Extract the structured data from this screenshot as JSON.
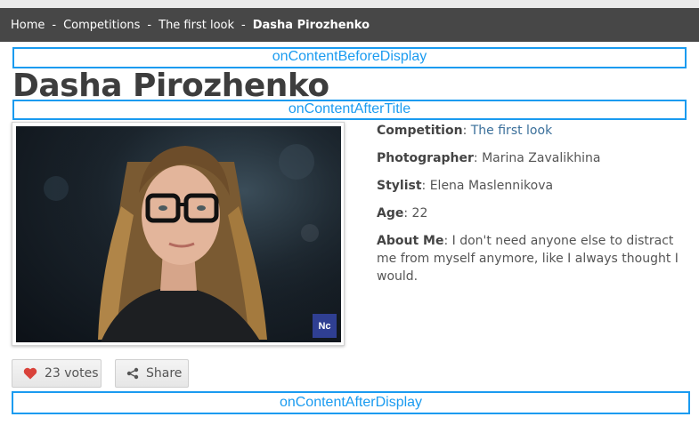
{
  "breadcrumb": {
    "items": [
      "Home",
      "Competitions",
      "The first look"
    ],
    "separator": "-",
    "current": "Dasha Pirozhenko"
  },
  "hooks": {
    "before_display": "onContentBeforeDisplay",
    "after_title": "onContentAfterTitle",
    "after_display": "onContentAfterDisplay"
  },
  "title": "Dasha Pirozhenko",
  "photo": {
    "badge": "Nc"
  },
  "details": {
    "competition_label": "Competition",
    "competition_value": "The first look",
    "photographer_label": "Photographer",
    "photographer_value": "Marina Zavalikhina",
    "stylist_label": "Stylist",
    "stylist_value": "Elena Maslennikova",
    "age_label": "Age",
    "age_value": "22",
    "about_label": "About Me",
    "about_value": "I don't need anyone else to distract me from myself anymore, like I always thought I would."
  },
  "buttons": {
    "votes_label": "23 votes",
    "share_label": "Share"
  },
  "colors": {
    "breadcrumb_bg": "#474747",
    "hook_border": "#1a9bf0",
    "heart": "#d9423a",
    "link": "#3a6f9a",
    "badge": "#2f3f92"
  },
  "icons": [
    "heart-icon",
    "share-icon"
  ]
}
